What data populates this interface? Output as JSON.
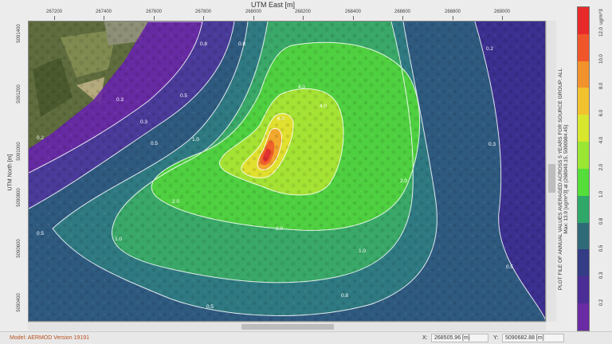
{
  "axes": {
    "top_title": "UTM East [m]",
    "top_ticks": [
      "267200",
      "267400",
      "267600",
      "267800",
      "268000",
      "268200",
      "268400",
      "268600",
      "268800",
      "269000"
    ],
    "left_title": "UTM North [m]",
    "left_ticks": [
      "5091400",
      "5091200",
      "5091000",
      "5090800",
      "5090600",
      "5090400"
    ]
  },
  "contour_labels": [
    "0.2",
    "0.3",
    "0.5",
    "1.0",
    "2.0",
    "4.0",
    "6.0",
    "0.8",
    "0.3",
    "0.5",
    "1.0",
    "2.0",
    "4.0",
    "0.5",
    "0.8",
    "1.0",
    "2.0",
    "0.5",
    "0.3",
    "0.2",
    "0.8",
    "0.5"
  ],
  "legend": {
    "unit": "ug/m^3",
    "caption_line1": "PLOT FILE OF ANNUAL VALUES AVERAGED ACROSS 5 YEARS FOR SOURCE GROUP: ALL",
    "caption_line2": "Max: 13.9 [ug/m^3] at (268040.15, 5090984.45)",
    "levels": [
      "12.0",
      "10.0",
      "8.0",
      "6.0",
      "4.0",
      "2.0",
      "1.0",
      "0.8",
      "0.5",
      "0.3",
      "0.2"
    ],
    "colors": [
      "#e82a2a",
      "#f0562a",
      "#f2922c",
      "#f2c22e",
      "#d8e62e",
      "#9ae633",
      "#55dd3a",
      "#2fa86a",
      "#2f6a78",
      "#343c86",
      "#4b2d96",
      "#6a2aa4"
    ]
  },
  "status": {
    "model": "Model: AERMOD Version 19191",
    "x_label": "X:",
    "x_value": "268505.96 [m]",
    "y_label": "Y:",
    "y_value": "5090682.88 [m]"
  }
}
